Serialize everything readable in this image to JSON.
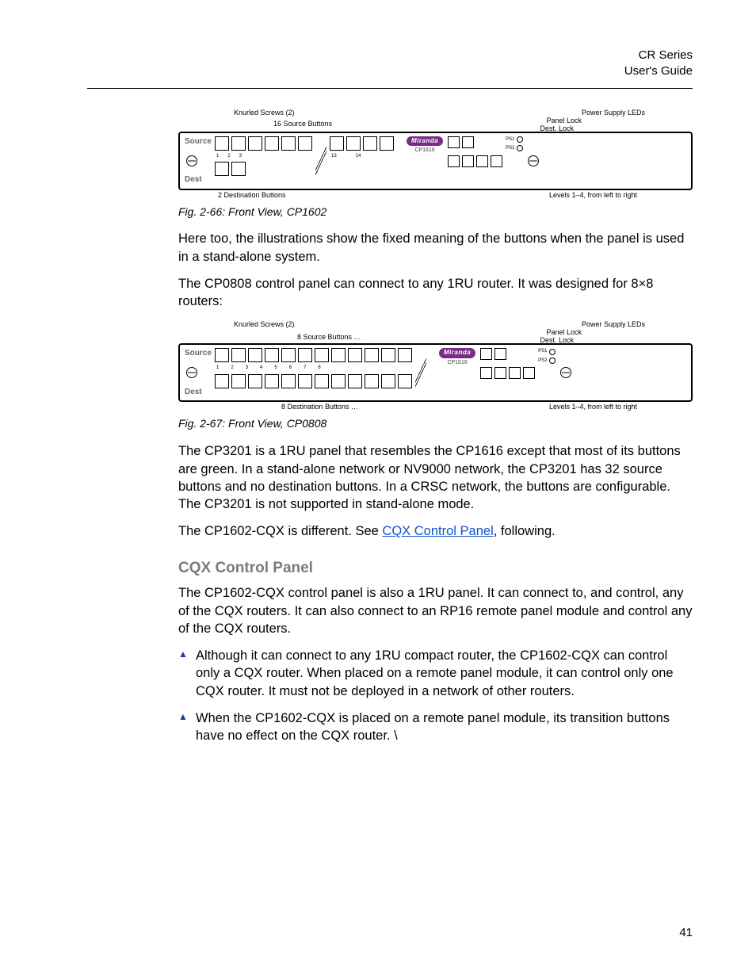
{
  "header": {
    "series": "CR Series",
    "doc": "User's Guide"
  },
  "fig1": {
    "callouts": {
      "screws": "Knurled Screws (2)",
      "srcbtns": "16 Source Buttons",
      "psleds": "Power Supply LEDs",
      "panellock": "Panel Lock",
      "destlock": "Dest. Lock"
    },
    "left_label_top": "Source",
    "left_label_bot": "Dest",
    "brand": "Miranda",
    "model": "CP1616",
    "ps1": "PS1",
    "ps2": "PS2",
    "below_left": "2 Destination Buttons",
    "below_right": "Levels 1–4, from left to right",
    "caption": "Fig. 2-66: Front View, CP1602"
  },
  "para1": "Here too, the illustrations show the fixed meaning of the buttons when the panel is used in a stand-alone system.",
  "para2": "The CP0808 control panel can connect to any 1RU router. It was designed for 8×8 routers:",
  "fig2": {
    "callouts": {
      "screws": "Knurled Screws (2)",
      "srcbtns": "8 Source Buttons …",
      "psleds": "Power Supply LEDs",
      "panellock": "Panel Lock",
      "destlock": "Dest. Lock"
    },
    "left_label_top": "Source",
    "left_label_bot": "Dest",
    "brand": "Miranda",
    "model": "CP1616",
    "ps1": "PS1",
    "ps2": "PS2",
    "below_left": "8 Destination Buttons …",
    "below_right": "Levels 1–4, from left to right",
    "caption": "Fig. 2-67: Front View, CP0808"
  },
  "para3": "The CP3201 is a 1RU panel that resembles the CP1616 except that most of its buttons are green. In a stand-alone network or NV9000 network, the CP3201 has 32 source buttons and no destination buttons. In a CRSC network, the buttons are configurable. The CP3201 is not supported in stand-alone mode.",
  "para4_pre": "The CP1602-CQX is different. See ",
  "para4_link": "CQX Control Panel",
  "para4_post": ", following.",
  "section_title": "CQX Control Panel",
  "para5": "The CP1602-CQX control panel is also a 1RU panel. It can connect to, and control, any of the CQX routers. It can also connect to an RP16 remote panel module and control any of the CQX routers.",
  "bullet1": "Although it can connect to any 1RU compact router, the CP1602-CQX can control only a CQX router. When placed on a remote panel module, it can control only one CQX router. It must not be deployed in a network of other routers.",
  "bullet2": "When the CP1602-CQX is placed on a remote panel module, its transition buttons have no effect on the CQX router. \\",
  "page_number": "41"
}
